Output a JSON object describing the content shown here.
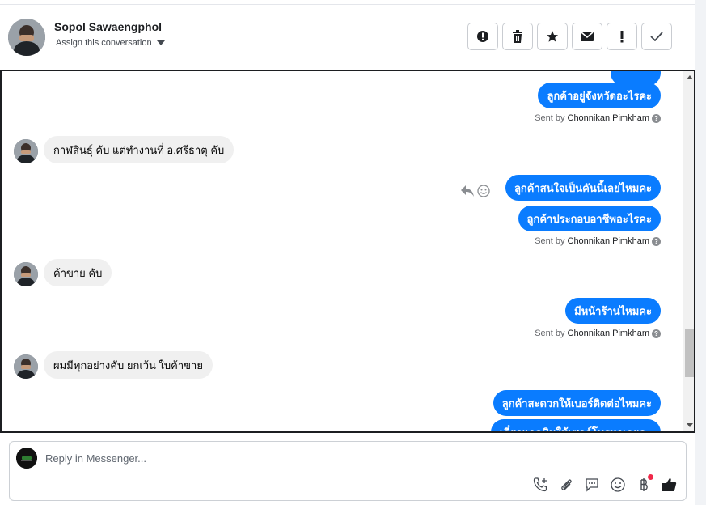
{
  "header": {
    "contact_name": "Sopol Sawaengphol",
    "assign_label": "Assign this conversation",
    "toolbar_icons": [
      "spam-icon",
      "trash-icon",
      "star-icon",
      "mail-icon",
      "important-icon",
      "check-icon"
    ]
  },
  "messages": {
    "out_1": "ลูกค้าอยู่จังหวัดอะไรคะ",
    "sent_prefix": "Sent by",
    "sent_agent": "Chonnikan Pimkham",
    "in_1": "กาฬสินธุ์ คับ แต่ทำงานที่ อ.ศรีธาตุ คับ",
    "out_2": "ลูกค้าสนใจเป็นคันนี้เลยไหมคะ",
    "out_3": "ลูกค้าประกอบอาชีพอะไรคะ",
    "in_2": "ค้าขาย คับ",
    "out_4": "มีหน้าร้านไหมคะ",
    "in_3": "ผมมีทุกอย่างคับ ยกเว้น ใบค้าขาย",
    "out_5": "ลูกค้าสะดวกให้เบอร์ติดต่อไหมคะ",
    "out_6_partial": "เดี๋ยวแอดมินให้เซลล์โทรหาเลยคะ"
  },
  "reply": {
    "placeholder": "Reply in Messenger...",
    "tools": [
      "call-add-icon",
      "attach-icon",
      "saved-reply-icon",
      "emoji-icon",
      "baht-icon",
      "like-icon"
    ]
  },
  "colors": {
    "accent": "#0a7cff",
    "incoming_bubble": "#f0f0f0",
    "badge": "#f02849"
  }
}
